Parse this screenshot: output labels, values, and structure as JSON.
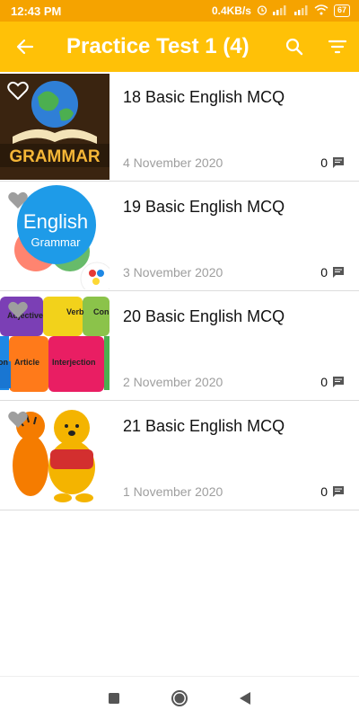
{
  "status_bar": {
    "time": "12:43 PM",
    "speed": "0.4KB/s",
    "battery": "67"
  },
  "app_bar": {
    "title": "Practice Test 1 (4)",
    "back_icon": "arrow-back-icon",
    "search_icon": "search-icon",
    "filter_icon": "filter-icon"
  },
  "items": [
    {
      "title": "18 Basic English MCQ",
      "date": "4 November 2020",
      "comments": "0",
      "thumb": "GRAMMAR"
    },
    {
      "title": "19 Basic English MCQ",
      "date": "3 November 2020",
      "comments": "0",
      "thumb_line1": "English",
      "thumb_line2": "Grammar"
    },
    {
      "title": "20 Basic English MCQ",
      "date": "2 November 2020",
      "comments": "0",
      "pieces": [
        "Adjective",
        "Verb",
        "Con",
        "on",
        "Article",
        "Interjection"
      ]
    },
    {
      "title": "21 Basic English MCQ",
      "date": "1 November 2020",
      "comments": "0"
    }
  ],
  "colors": {
    "status_bar": "#f5a300",
    "app_bar": "#ffc107"
  }
}
